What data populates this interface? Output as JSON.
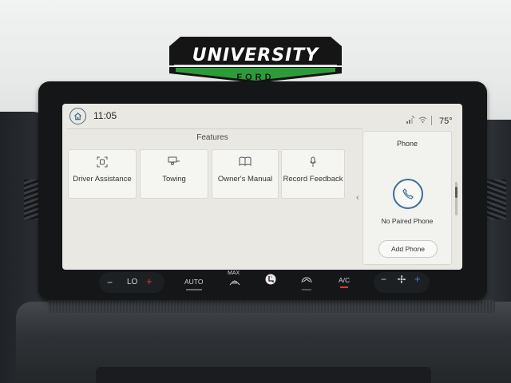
{
  "dealer": {
    "name": "UNIVERSITY",
    "sub": "FORD"
  },
  "status_bar": {
    "time": "11:05",
    "temperature": "75°"
  },
  "features": {
    "title": "Features",
    "items": [
      {
        "label": "Driver Assistance",
        "icon": "driver-assist-icon"
      },
      {
        "label": "Towing",
        "icon": "trailer-icon"
      },
      {
        "label": "Owner's Manual",
        "icon": "book-icon"
      },
      {
        "label": "Record Feedback",
        "icon": "microphone-icon"
      }
    ]
  },
  "phone": {
    "title": "Phone",
    "status": "No Paired Phone",
    "add_label": "Add Phone"
  },
  "climate": {
    "left_minus": "−",
    "left_temp": "LO",
    "left_plus": "+",
    "auto": "AUTO",
    "max": "MAX",
    "ac": "A/C",
    "fan_minus": "−",
    "fan_plus": "+"
  },
  "colors": {
    "accent": "#3f6d98",
    "screen_bg": "#e9e8e2",
    "logo_green": "#2e9b3a",
    "indicator_red": "#d23a3a"
  }
}
